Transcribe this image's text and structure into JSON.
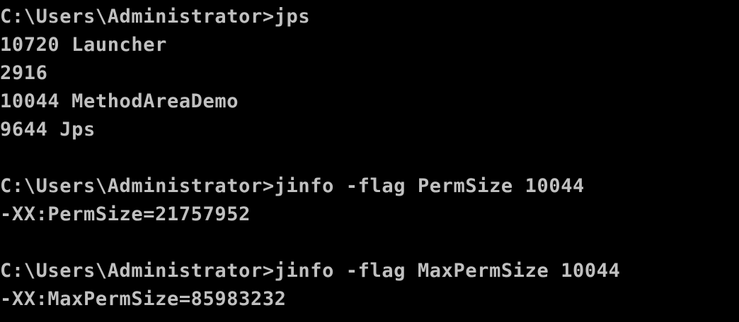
{
  "terminal": {
    "lines": [
      "C:\\Users\\Administrator>jps",
      "10720 Launcher",
      "2916",
      "10044 MethodAreaDemo",
      "9644 Jps",
      "",
      "C:\\Users\\Administrator>jinfo -flag PermSize 10044",
      "-XX:PermSize=21757952",
      "",
      "C:\\Users\\Administrator>jinfo -flag MaxPermSize 10044",
      "-XX:MaxPermSize=85983232"
    ],
    "colors": {
      "background": "#000000",
      "foreground": "#c0c0c0"
    }
  }
}
